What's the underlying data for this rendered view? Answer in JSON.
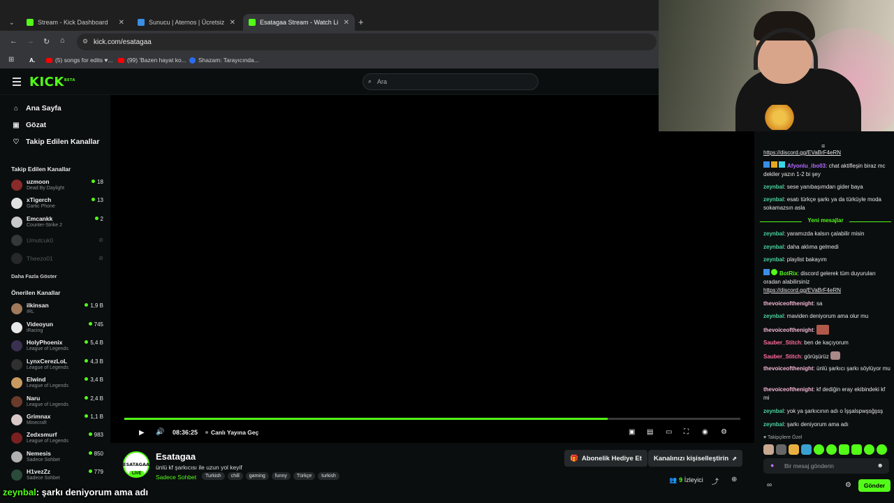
{
  "browser": {
    "tabs": [
      {
        "title": "Stream - Kick Dashboard"
      },
      {
        "title": "Sunucu | Aternos | Ücretsiz Min"
      },
      {
        "title": "Esatagaa Stream - Watch Live o"
      }
    ],
    "url": "kick.com/esatagaa",
    "bookmarks": [
      "(5) songs for edits ♥...",
      "(99) 'Bazen hayat ko...",
      "Shazam: Tarayıcında..."
    ]
  },
  "site": {
    "logo": "KICK",
    "logo_sup": "BETA",
    "search_placeholder": "Ara"
  },
  "sidebar": {
    "nav": [
      {
        "label": "Ana Sayfa",
        "icon": "home-icon"
      },
      {
        "label": "Gözat",
        "icon": "browse-icon"
      },
      {
        "label": "Takip Edilen Kanallar",
        "icon": "heart-icon"
      }
    ],
    "followed_title": "Takip Edilen Kanallar",
    "followed": [
      {
        "name": "uzmoon",
        "category": "Dead By Daylight",
        "viewers": "18"
      },
      {
        "name": "xTigerch",
        "category": "Gartic Phone",
        "viewers": "13"
      },
      {
        "name": "Emcankk",
        "category": "Counter-Strike 2",
        "viewers": "2"
      },
      {
        "name": "Umutcuk0",
        "category": "",
        "viewers": ""
      },
      {
        "name": "Theezo01",
        "category": "",
        "viewers": ""
      }
    ],
    "show_more": "Daha Fazla Göster",
    "recommended_title": "Önerilen Kanallar",
    "recommended": [
      {
        "name": "ilkinsan",
        "category": "IRL",
        "viewers": "1,9 B"
      },
      {
        "name": "Videoyun",
        "category": "iRacing",
        "viewers": "745"
      },
      {
        "name": "HolyPhoenix",
        "category": "League of Legends",
        "viewers": "5,4 B"
      },
      {
        "name": "LynxCerezLoL",
        "category": "League of Legends",
        "viewers": "4,3 B"
      },
      {
        "name": "Elwind",
        "category": "League of Legends",
        "viewers": "3,4 B"
      },
      {
        "name": "Naru",
        "category": "League of Legends",
        "viewers": "2,4 B"
      },
      {
        "name": "Grimnax",
        "category": "Minecraft",
        "viewers": "1,1 B"
      },
      {
        "name": "Zedxsmurf",
        "category": "League of Legends",
        "viewers": "983"
      },
      {
        "name": "Nemesis",
        "category": "Sadece Sohbet",
        "viewers": "850"
      },
      {
        "name": "H1vezZz",
        "category": "Sadece Sohbet",
        "viewers": "779"
      }
    ]
  },
  "player": {
    "time": "08:36:25",
    "go_live": "Canlı Yayına Geç",
    "progress": 0.785
  },
  "stream": {
    "avatar_text": "ESATAGAA",
    "live_badge": "LIVE",
    "name": "Esatagaa",
    "title": "ünlü kf şarkıcısı ile uzun yol keyif",
    "category": "Sadece Sohbet",
    "tags": [
      "Turkish",
      "chill",
      "gaming",
      "funny",
      "Türkçe",
      "turkish"
    ],
    "gift_button": "Abonelik Hediye Et",
    "customize_button": "Kanalınızı kişiselleştirin",
    "viewers_count": "9",
    "viewers_label": "İzleyici"
  },
  "chat": {
    "messages": [
      {
        "user": "",
        "text": "https://discord.gg/EVaBrF4eRN",
        "link": true,
        "color": "#e6e6e6"
      },
      {
        "user": "Afyonlu_ibo03",
        "text": "chat aktifleşin biraz mc dekiler yazın 1-2 bi şey",
        "color": "#b36bff"
      },
      {
        "user": "zeynbal",
        "text": "sese yanıbaşımdan gider baya",
        "color": "#4ad6a0"
      },
      {
        "user": "zeynbal",
        "text": "esatı türkçe şarkı ya da türküyle moda sokamazsın asla",
        "color": "#4ad6a0"
      },
      {
        "user": "zeynbal",
        "text": "yaramızda kalsın çalabilir misin",
        "color": "#4ad6a0"
      },
      {
        "user": "zeynbal",
        "text": "daha aklıma gelmedi",
        "color": "#4ad6a0"
      },
      {
        "user": "zeynbal",
        "text": "playlist bakayım",
        "color": "#4ad6a0"
      },
      {
        "user": "BotRix",
        "text": "discord gelerek tüm duyuruları oradan alabilirsiniz",
        "color": "#53fc18"
      },
      {
        "user": "",
        "text": "https://discord.gg/EVaBrF4eRN",
        "link": true,
        "color": "#e6e6e6"
      },
      {
        "user": "thevoiceofthenight",
        "text": "sa",
        "color": "#f5b8d6"
      },
      {
        "user": "zeynbal",
        "text": "maviden deniyorum ama olur mu",
        "color": "#4ad6a0"
      },
      {
        "user": "thevoiceofthenight",
        "text": "",
        "color": "#f5b8d6"
      },
      {
        "user": "Sauber_Stitch",
        "text": "ben de kaçıyorum",
        "color": "#ff6b9a"
      },
      {
        "user": "Sauber_Stitch",
        "text": "görüşürüz",
        "color": "#ff6b9a"
      },
      {
        "user": "thevoiceofthenight",
        "text": "ünlü şarkıcı şarkı söylüyor mu",
        "color": "#f5b8d6"
      },
      {
        "user": "thevoiceofthenight",
        "text": "kf dediğin eray ekibindeki kf mi",
        "color": "#f5b8d6"
      },
      {
        "user": "zeynbal",
        "text": "yok ya şarkıcının adı o İşşalspwşsğşsş",
        "color": "#4ad6a0"
      },
      {
        "user": "zeynbal",
        "text": "şarkı deniyorum ama adı",
        "color": "#4ad6a0"
      }
    ],
    "new_messages": "Yeni mesajlar",
    "subscriber_header": "Takipçilere Özel",
    "input_placeholder": "Bir mesaj gönderin",
    "send_button": "Gönder",
    "accent": "#53fc18"
  },
  "caption": {
    "user": "zeynbal",
    "text": ": şarkı deniyorum ama adı"
  }
}
